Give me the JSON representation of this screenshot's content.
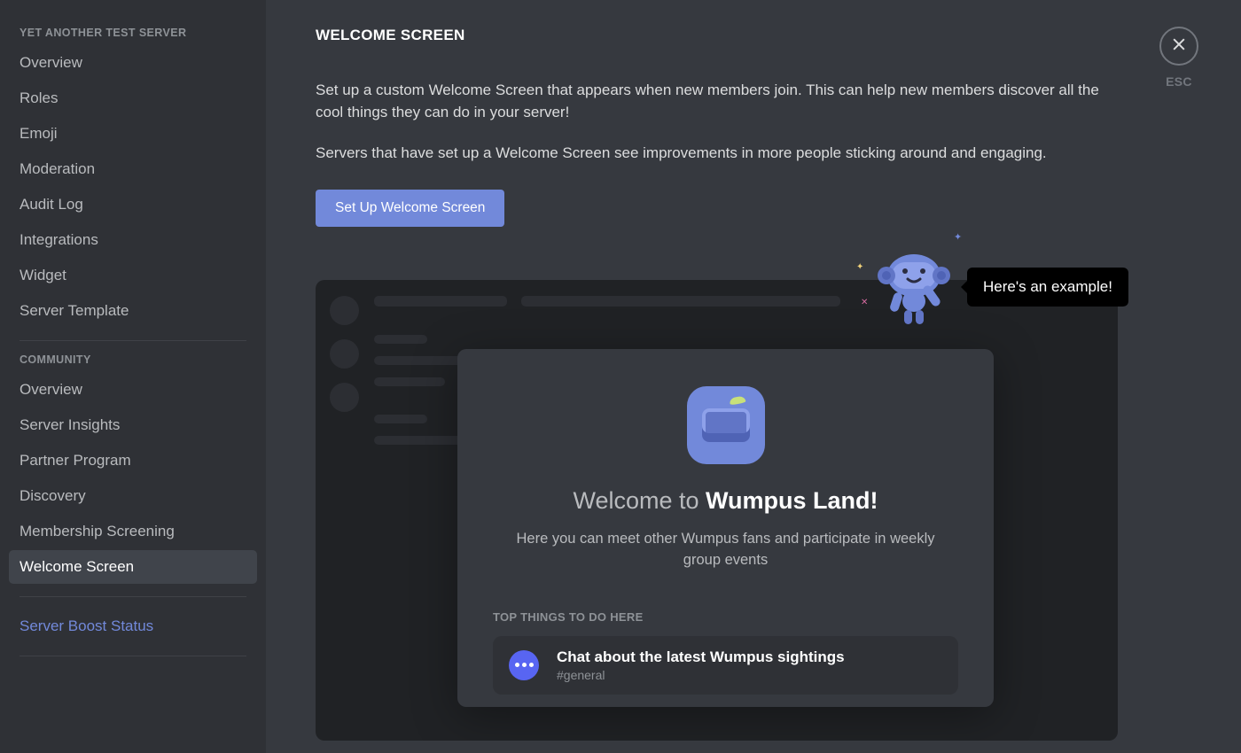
{
  "sidebar": {
    "group1_heading": "YET ANOTHER TEST SERVER",
    "group1_items": [
      {
        "label": "Overview",
        "name": "sidebar-item-overview",
        "active": false
      },
      {
        "label": "Roles",
        "name": "sidebar-item-roles",
        "active": false
      },
      {
        "label": "Emoji",
        "name": "sidebar-item-emoji",
        "active": false
      },
      {
        "label": "Moderation",
        "name": "sidebar-item-moderation",
        "active": false
      },
      {
        "label": "Audit Log",
        "name": "sidebar-item-audit-log",
        "active": false
      },
      {
        "label": "Integrations",
        "name": "sidebar-item-integrations",
        "active": false
      },
      {
        "label": "Widget",
        "name": "sidebar-item-widget",
        "active": false
      },
      {
        "label": "Server Template",
        "name": "sidebar-item-server-template",
        "active": false
      }
    ],
    "group2_heading": "COMMUNITY",
    "group2_items": [
      {
        "label": "Overview",
        "name": "sidebar-item-community-overview",
        "active": false
      },
      {
        "label": "Server Insights",
        "name": "sidebar-item-server-insights",
        "active": false
      },
      {
        "label": "Partner Program",
        "name": "sidebar-item-partner-program",
        "active": false
      },
      {
        "label": "Discovery",
        "name": "sidebar-item-discovery",
        "active": false
      },
      {
        "label": "Membership Screening",
        "name": "sidebar-item-membership-screening",
        "active": false
      },
      {
        "label": "Welcome Screen",
        "name": "sidebar-item-welcome-screen",
        "active": true
      }
    ],
    "boost_label": "Server Boost Status"
  },
  "header": {
    "title": "WELCOME SCREEN",
    "close_label": "ESC"
  },
  "body": {
    "paragraph1": "Set up a custom Welcome Screen that appears when new members join. This can help new members discover all the cool things they can do in your server!",
    "paragraph2": "Servers that have set up a Welcome Screen see improvements in more people sticking around and engaging.",
    "cta_label": "Set Up Welcome Screen"
  },
  "example": {
    "tooltip": "Here's an example!",
    "welcome_prefix": "Welcome to ",
    "server_name": "Wumpus Land!",
    "subtitle": "Here you can meet other Wumpus fans and participate in weekly group events",
    "section_header": "TOP THINGS TO DO HERE",
    "channels": [
      {
        "title": "Chat about the latest Wumpus sightings",
        "channel": "#general",
        "icon": "chat-bubble"
      }
    ]
  },
  "colors": {
    "accent": "#7289da",
    "bg_dark": "#2f3136",
    "bg_darker": "#202225",
    "bg": "#36393f"
  }
}
